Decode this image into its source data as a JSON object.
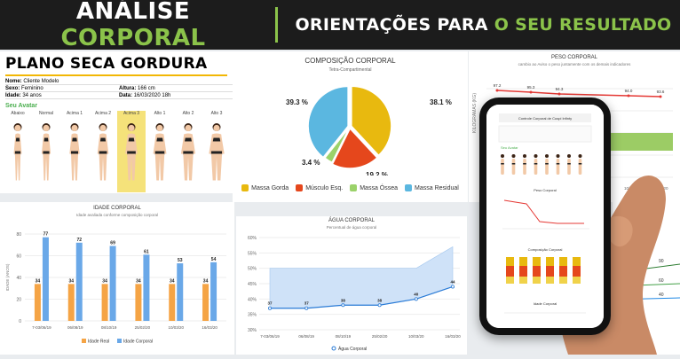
{
  "banner": {
    "left_white": "ANÁLISE",
    "left_green": "CORPORAL",
    "right_white": "ORIENTAÇÕES PARA",
    "right_green": "O SEU RESULTADO",
    "accent": "#8bc34a"
  },
  "plan": {
    "title": "PLANO SECA GORDURA",
    "nome_label": "Nome:",
    "nome": "Cliente Modelo",
    "sexo_label": "Sexo:",
    "sexo": "Feminino",
    "idade_label": "Idade:",
    "idade": "34 anos",
    "altura_label": "Altura:",
    "altura": "166 cm",
    "data_label": "Data:",
    "data": "16/03/2020 18h",
    "avatar_title": "Seu Avatar",
    "avatars": [
      "Abaixo",
      "Normal",
      "Acima 1",
      "Acima 2",
      "Acima 3",
      "Alto 1",
      "Alto 2",
      "Alto 3"
    ],
    "selected": 4
  },
  "composicao": {
    "title": "COMPOSIÇÃO CORPORAL",
    "subtitle": "Tetra-Compartimental",
    "labels": [
      "38.1 %",
      "19.2 %",
      "3.4 %",
      "39.3 %"
    ],
    "legend": [
      "Massa Gorda",
      "Músculo Esq.",
      "Massa Óssea",
      "Massa Residual"
    ]
  },
  "peso": {
    "title": "PESO CORPORAL",
    "subtitle": "cambio ao Aviso o peso juntamente com os demais indicadores",
    "values": [
      "97.2",
      "95.3",
      "94.3",
      "94.0",
      "93.6"
    ]
  },
  "idade": {
    "title": "IDADE CORPORAL",
    "subtitle": "Idade avaliada conforme composição corporal",
    "ylabel": "IDADE (ANOS)",
    "legend": [
      "Idade Real",
      "Idade Corporal"
    ]
  },
  "agua": {
    "title": "ÁGUA CORPORAL",
    "subtitle": "Percentual de água corporal",
    "legend": "Água Corporal"
  },
  "phone": {
    "title": "Controle Corporal de Cuspi Infinty",
    "peso_title": "Peso Corporal",
    "comp_title": "Composição Corporal",
    "idade_title": "Idade Corporal",
    "avatar_title": "Seu Avatar"
  },
  "chart_data": [
    {
      "type": "pie",
      "title": "COMPOSIÇÃO CORPORAL",
      "subtitle": "Tetra-Compartimental",
      "categories": [
        "Massa Gorda",
        "Músculo Esq.",
        "Massa Óssea",
        "Massa Residual"
      ],
      "values": [
        38.1,
        19.2,
        3.4,
        39.3
      ],
      "colors": [
        "#e8b90f",
        "#e5471c",
        "#9bd26a",
        "#5bb7e0"
      ],
      "legend": "bottom"
    },
    {
      "type": "bar",
      "title": "IDADE CORPORAL",
      "subtitle": "Idade avaliada conforme composição corporal",
      "ylabel": "IDADE (ANOS)",
      "categories": [
        "7-03/06/19",
        "06/08/19",
        "08/10/19",
        "25/02/20",
        "10/03/20",
        "16/03/20"
      ],
      "series": [
        {
          "name": "Idade Real",
          "values": [
            34,
            34,
            34,
            34,
            34,
            34
          ],
          "color": "#f5a445"
        },
        {
          "name": "Idade Corporal",
          "values": [
            77,
            72,
            69,
            61,
            53,
            54
          ],
          "color": "#6aa8e8"
        }
      ],
      "ylim": [
        0,
        80
      ],
      "yticks": [
        0,
        20,
        40,
        60,
        80
      ],
      "legend": "bottom"
    },
    {
      "type": "area",
      "title": "ÁGUA CORPORAL",
      "subtitle": "Percentual de água corporal",
      "categories": [
        "7-03/06/19",
        "06/08/19",
        "08/10/19",
        "25/02/20",
        "10/03/20",
        "16/03/20"
      ],
      "series": [
        {
          "name": "Água Corporal",
          "values": [
            37,
            37,
            38,
            38,
            40,
            44
          ],
          "color": "#2a7bd6"
        }
      ],
      "ylim": [
        30,
        60
      ],
      "yticks": [
        "30%",
        "35%",
        "40%",
        "45%",
        "50%",
        "55%",
        "60%"
      ],
      "legend": "bottom"
    }
  ]
}
